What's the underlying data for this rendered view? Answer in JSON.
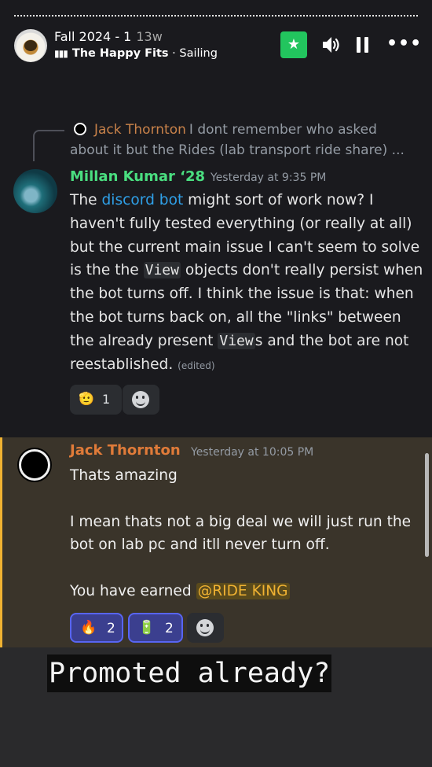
{
  "story": {
    "title": "Fall 2024 - 1",
    "age": "13w",
    "song": "The Happy Fits",
    "song_genre": "Sailing",
    "bars_icon": "▮▮▮"
  },
  "icons": {
    "star": "★",
    "more": "•••"
  },
  "reply": {
    "author": "Jack Thornton",
    "preview": "I dont remember who asked about it but the Rides (lab transport ride share) ..."
  },
  "message1": {
    "author": "Millan Kumar ‘28",
    "time": "Yesterday at 9:35 PM",
    "t1": "The ",
    "link": "discord bot",
    "t2": " might sort of work now? I haven't fully tested everything (or really at all) but the current main issue I can't seem to solve is the the ",
    "code1": "View",
    "t3": " objects don't really persist when the bot turns off. I think the issue is that: when the bot turns back on, all the \"links\" between the already present ",
    "code2": "View",
    "t4": "s and the bot are not reestablished.",
    "edited": "(edited)",
    "reaction_emoji": "🫡",
    "reaction_count": "1"
  },
  "message2": {
    "author": "Jack Thornton",
    "time": "Yesterday at 10:05 PM",
    "line1": "Thats amazing",
    "line2": "I mean thats not a big deal we will just run the bot on lab pc and itll never turn off.",
    "line3_prefix": "You have earned ",
    "mention": "@RIDE KING",
    "reactions": [
      {
        "emoji": "🔥",
        "count": "2"
      },
      {
        "emoji": "🔋",
        "count": "2"
      }
    ]
  },
  "caption": "Promoted already?",
  "colors": {
    "accent_green": "#22c55e",
    "author_green": "#4ade80",
    "author_orange": "#e07b39",
    "mention_gold": "#f0b232",
    "link_blue": "#2fa0e8"
  }
}
